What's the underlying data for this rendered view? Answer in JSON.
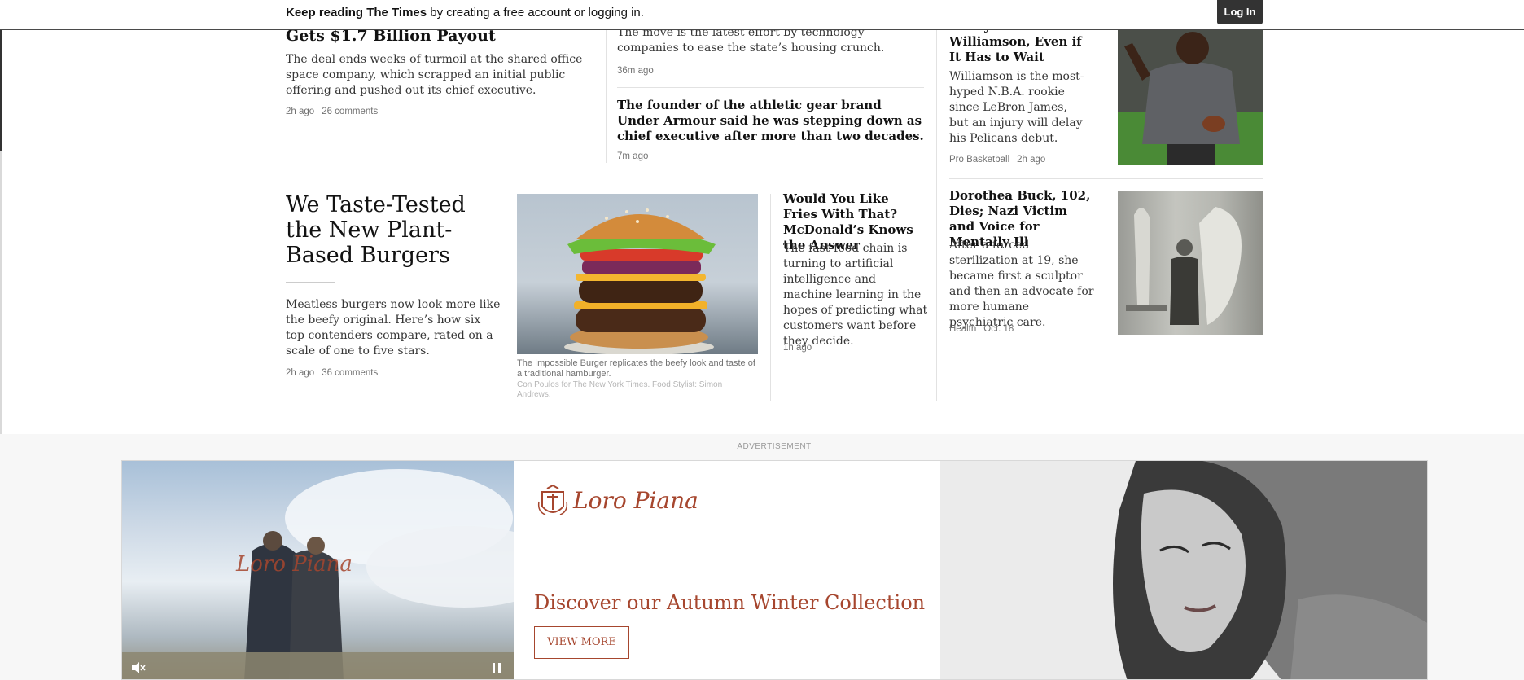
{
  "banner": {
    "bold_text": "Keep reading The Times",
    "text": " by creating a free account or logging in.",
    "login_label": "Log In"
  },
  "col1_story": {
    "headline": "Gets $1.7 Billion Payout",
    "summary": "The deal ends weeks of turmoil at the shared office space company, which scrapped an initial public offering and pushed out its chief executive.",
    "time": "2h ago",
    "comments": "26 comments"
  },
  "col2_story1": {
    "summary": "The move is the latest effort by technology companies to ease the state’s housing crunch.",
    "time": "36m ago"
  },
  "col2_story2": {
    "headline": "The founder of the athletic gear brand Under Armour said he was stepping down as chief executive after more than two decades.",
    "time": "7m ago"
  },
  "feature": {
    "headline": "We Taste-Tested the New Plant-Based Burgers",
    "summary": "Meatless burgers now look more like the beefy original. Here’s how six top contenders compare, rated on a scale of one to five stars.",
    "time": "2h ago",
    "comments": "36 comments",
    "caption": "The Impossible Burger replicates the beefy look and taste of a traditional hamburger.",
    "credit": "Con Poulos for The New York Times. Food Stylist: Simon Andrews."
  },
  "mcd_story": {
    "headline": "Would You Like Fries With That? McDonald’s Knows the Answer",
    "summary": "The fast-food chain is turning to artificial intelligence and machine learning in the hopes of predicting what customers want before they decide.",
    "time": "1h ago"
  },
  "zion_story": {
    "headline": "New Orleans Is Ready to Love Zion Williamson, Even if It Has to Wait",
    "summary": "Williamson is the most-hyped N.B.A. rookie since LeBron James, but an injury will delay his Pelicans debut.",
    "section": "Pro Basketball",
    "time": "2h ago"
  },
  "buck_story": {
    "headline": "Dorothea Buck, 102, Dies; Nazi Victim and Voice for Mentally Ill",
    "summary": "After a forced sterilization at 19, she became first a sculptor and then an advocate for more humane psychiatric care.",
    "section": "Health",
    "time": "Oct. 18"
  },
  "ad": {
    "label": "ADVERTISEMENT",
    "brand": "Loro Piana",
    "headline": "Discover our Autumn Winter Collection",
    "button": "VIEW MORE"
  },
  "colors": {
    "brand": "#a6462e",
    "text": "#121212",
    "meta": "#727272"
  }
}
